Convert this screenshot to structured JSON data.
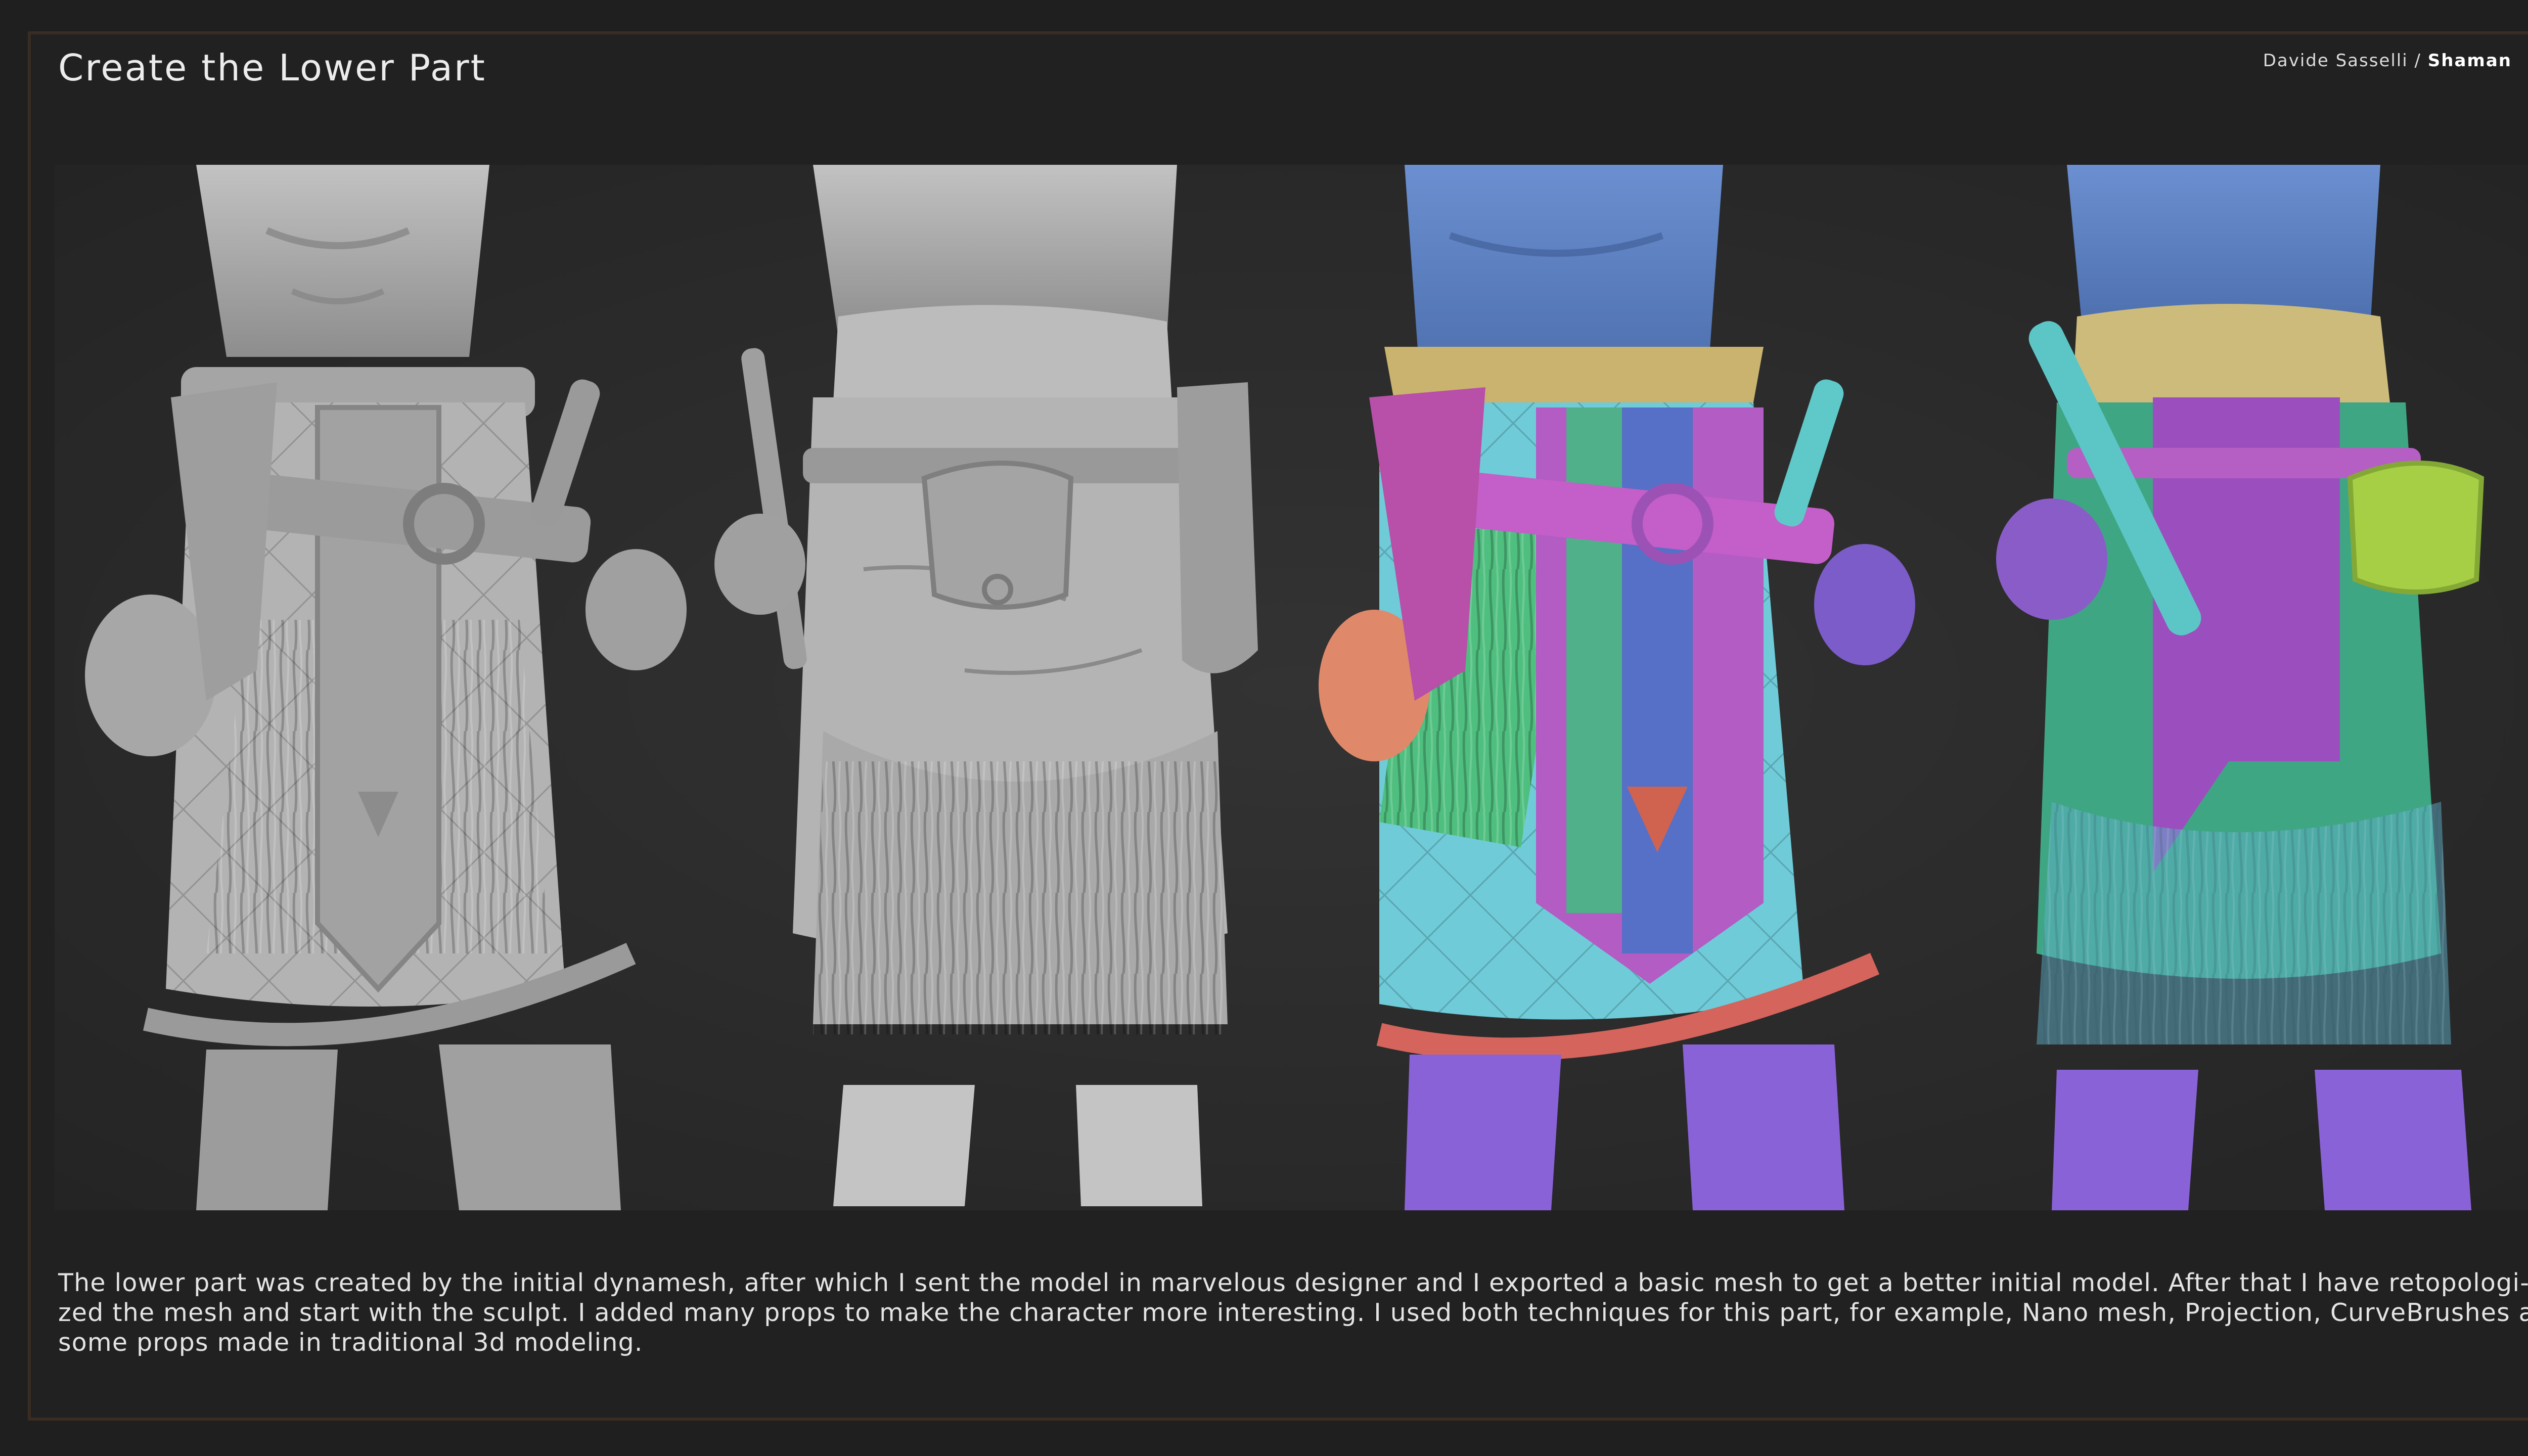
{
  "header": {
    "title": "Create the Lower Part",
    "author": "Davide Sasselli",
    "separator": " / ",
    "project": "Shaman"
  },
  "render": {
    "views": [
      {
        "name": "front-clay",
        "colors": [
          "#bdbdbd",
          "#a9a9a9",
          "#8e8e8e"
        ]
      },
      {
        "name": "back-clay",
        "colors": [
          "#c0c0c0",
          "#adadad",
          "#8f8f8f"
        ]
      },
      {
        "name": "front-polygroups",
        "colors": [
          "#5b7fbf",
          "#b05cc0",
          "#4fb08a",
          "#6ec9d6",
          "#8a63d8"
        ]
      },
      {
        "name": "back-polygroups",
        "colors": [
          "#5b86c9",
          "#9b4fbf",
          "#3fa684",
          "#a7cf46",
          "#7f5fd6"
        ]
      }
    ]
  },
  "description": {
    "lines": [
      "The lower part was created by the initial dynamesh, after which I sent the model in marvelous designer and I exported a basic mesh to get a better initial model. After that I have retopologi-",
      "zed the mesh and start with the sculpt. I added many props to make the character more interesting. I used both techniques for this part, for example, Nano mesh, Projection, CurveBrushes and",
      "some props made in traditional 3d modeling."
    ]
  }
}
